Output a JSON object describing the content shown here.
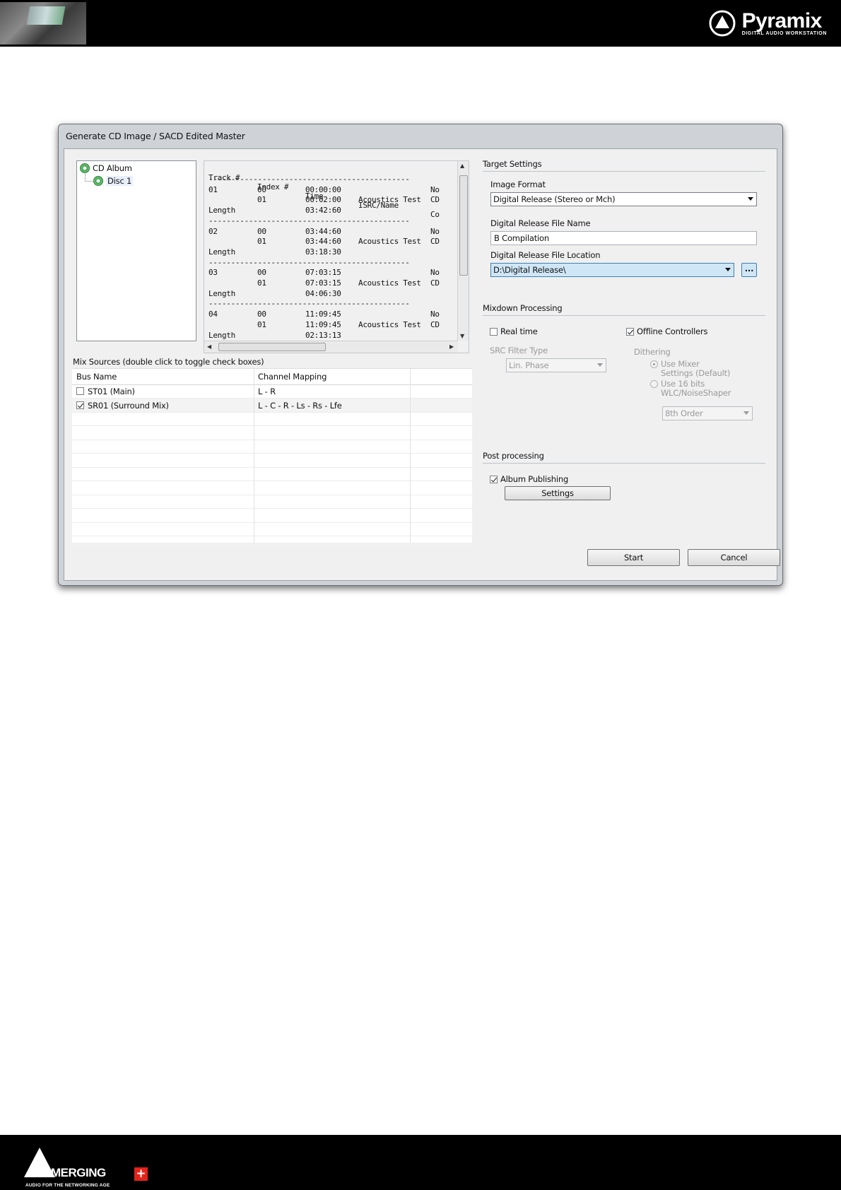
{
  "header": {
    "brand": "Pyramix",
    "tagline": "DIGITAL AUDIO WORKSTATION"
  },
  "footer": {
    "brand": "MERGING",
    "plus": "+",
    "tagline": "AUDIO FOR THE NETWORKING AGE"
  },
  "dialog": {
    "title": "Generate CD Image / SACD Edited Master",
    "tree": {
      "root": "CD Album",
      "child": "Disc 1"
    },
    "tracks": {
      "headers": [
        "Track #",
        "Index #",
        "Time",
        "ISRC/Name",
        "Co"
      ],
      "separator": "---------------------------------------------",
      "blocks": [
        {
          "track": "01",
          "rows": [
            {
              "index": "00",
              "time": "00:00:00",
              "name": "",
              "co": "No"
            },
            {
              "index": "01",
              "time": "00:02:00",
              "name": "Acoustics Test",
              "co": "CD"
            }
          ],
          "length_label": "Length",
          "length": "03:42:60"
        },
        {
          "track": "02",
          "rows": [
            {
              "index": "00",
              "time": "03:44:60",
              "name": "",
              "co": "No"
            },
            {
              "index": "01",
              "time": "03:44:60",
              "name": "Acoustics Test",
              "co": "CD"
            }
          ],
          "length_label": "Length",
          "length": "03:18:30"
        },
        {
          "track": "03",
          "rows": [
            {
              "index": "00",
              "time": "07:03:15",
              "name": "",
              "co": "No"
            },
            {
              "index": "01",
              "time": "07:03:15",
              "name": "Acoustics Test",
              "co": "CD"
            }
          ],
          "length_label": "Length",
          "length": "04:06:30"
        },
        {
          "track": "04",
          "rows": [
            {
              "index": "00",
              "time": "11:09:45",
              "name": "",
              "co": "No"
            },
            {
              "index": "01",
              "time": "11:09:45",
              "name": "Acoustics Test",
              "co": "CD"
            }
          ],
          "length_label": "Length",
          "length": "02:13:13"
        }
      ]
    },
    "mix_sources": {
      "label": "Mix Sources (double click to toggle check boxes)",
      "columns": [
        "Bus Name",
        "Channel Mapping"
      ],
      "rows": [
        {
          "checked": false,
          "bus": "ST01 (Main)",
          "mapping": "L - R"
        },
        {
          "checked": true,
          "bus": "SR01 (Surround Mix)",
          "mapping": "L - C - R - Ls - Rs - Lfe"
        }
      ]
    },
    "target": {
      "heading": "Target Settings",
      "image_format_label": "Image Format",
      "image_format": "Digital Release (Stereo or Mch)",
      "file_name_label": "Digital Release File Name",
      "file_name": "B Compilation",
      "file_location_label": "Digital Release File Location",
      "file_location": "D:\\Digital Release\\",
      "browse": "..."
    },
    "mixdown": {
      "heading": "Mixdown Processing",
      "real_time": {
        "label": "Real time",
        "checked": false
      },
      "offline_controllers": {
        "label": "Offline Controllers",
        "checked": true
      },
      "src_label": "SRC Filter Type",
      "src_value": "Lin. Phase",
      "dithering_label": "Dithering",
      "dither_opt1_line1": "Use Mixer",
      "dither_opt1_line2": "Settings (Default)",
      "dither_opt2_line1": "Use 16 bits",
      "dither_opt2_line2": "WLC/NoiseShaper",
      "order_value": "8th Order"
    },
    "post": {
      "heading": "Post processing",
      "album_publishing": {
        "label": "Album Publishing",
        "checked": true
      },
      "settings_button": "Settings"
    },
    "buttons": {
      "start": "Start",
      "cancel": "Cancel"
    }
  }
}
